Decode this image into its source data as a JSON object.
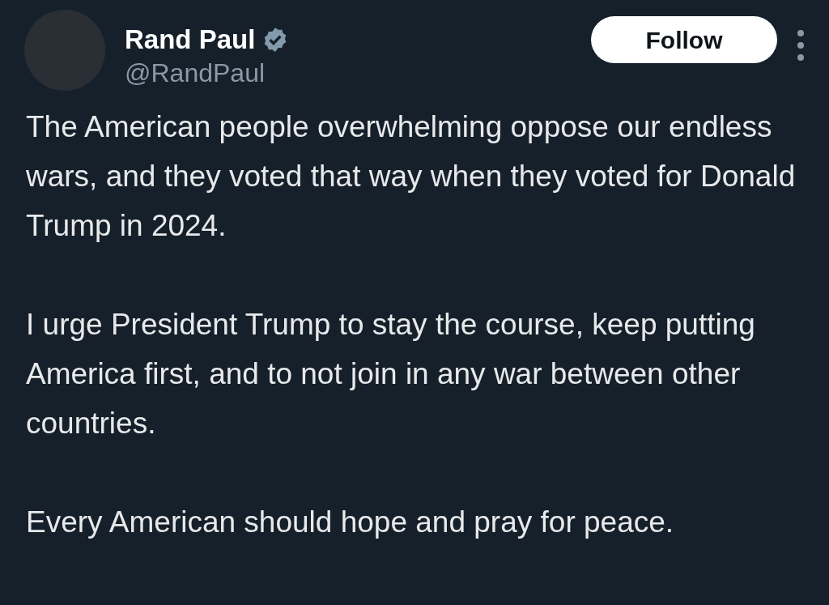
{
  "author": {
    "name": "Rand Paul",
    "handle": "@RandPaul",
    "verified": true
  },
  "follow_button": {
    "label": "Follow"
  },
  "paragraphs": [
    "The American people overwhelming oppose our endless wars, and they voted that way when they voted for Donald Trump in 2024.",
    "I urge President Trump to stay the course, keep putting America first, and to not join in any war between other countries.",
    "Every American should hope and pray for peace."
  ]
}
